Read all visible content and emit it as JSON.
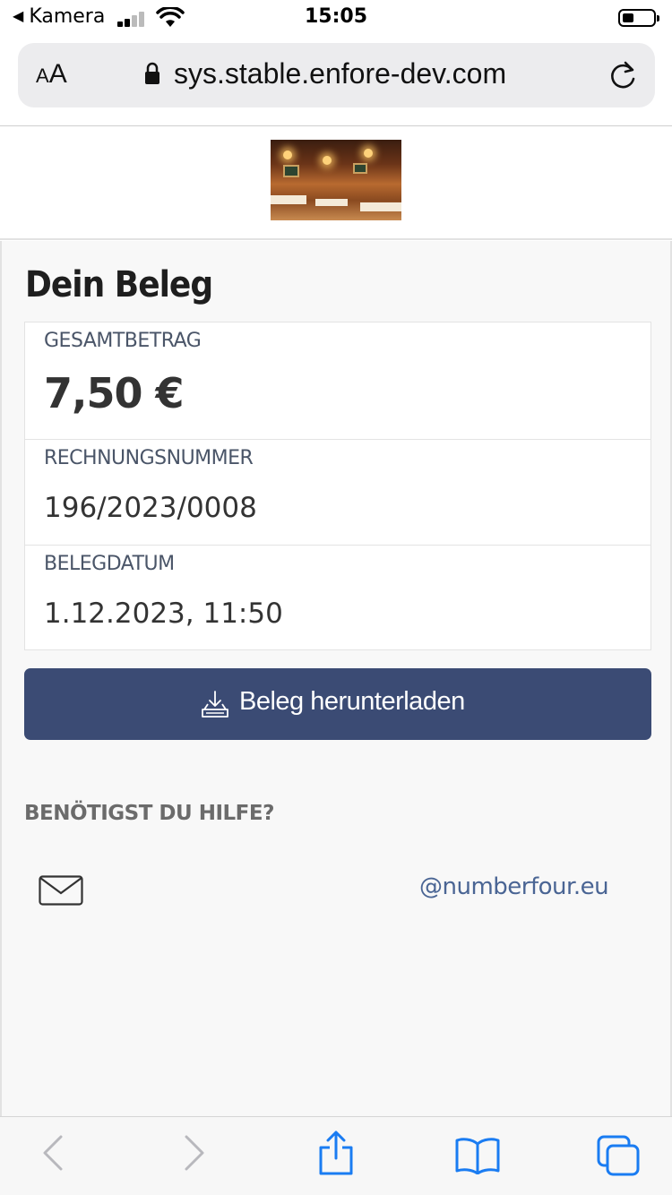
{
  "status_bar": {
    "back_app": "Kamera",
    "time": "15:05"
  },
  "browser": {
    "text_size_small": "A",
    "text_size_big": "A",
    "url": "sys.stable.enfore-dev.com"
  },
  "receipt": {
    "title": "Dein Beleg",
    "total_label": "GESAMTBETRAG",
    "total_value": "7,50 €",
    "invoice_label": "RECHNUNGSNUMMER",
    "invoice_value": "196/2023/0008",
    "date_label": "BELEGDATUM",
    "date_value": "1.12.2023, 11:50",
    "download_label": "Beleg herunterladen"
  },
  "help": {
    "title": "BENÖTIGST DU HILFE?",
    "email": "@numberfour.eu"
  },
  "colors": {
    "button": "#3b4b74",
    "link": "#4a6594",
    "ios_blue": "#1a7cf2"
  },
  "icons": {
    "signal": "signal-icon",
    "wifi": "wifi-icon",
    "battery": "battery-icon",
    "lock": "lock-icon",
    "reload": "reload-icon",
    "download": "download-icon",
    "mail": "mail-icon",
    "back": "chevron-left-icon",
    "forward": "chevron-right-icon",
    "share": "share-icon",
    "bookmarks": "book-icon",
    "tabs": "tabs-icon"
  }
}
